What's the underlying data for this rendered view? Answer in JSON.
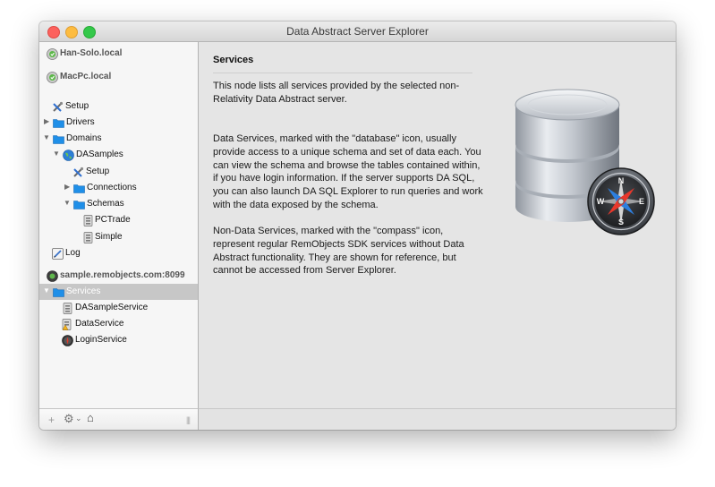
{
  "window": {
    "title": "Data Abstract Server Explorer"
  },
  "sidebar": {
    "tree": [
      {
        "label": "Han-Solo.local",
        "icon": "bonjour-server-icon",
        "kind": "server"
      },
      {
        "label": "MacPc.local",
        "icon": "bonjour-server-icon",
        "kind": "server"
      },
      {
        "label": "Setup",
        "icon": "tools-icon",
        "kind": "item"
      },
      {
        "label": "Drivers",
        "icon": "folder-icon",
        "kind": "folder",
        "expanded": false
      },
      {
        "label": "Domains",
        "icon": "folder-icon",
        "kind": "folder",
        "expanded": true
      },
      {
        "label": "DASamples",
        "icon": "globe-icon",
        "kind": "domain",
        "expanded": true
      },
      {
        "label": "Setup",
        "icon": "tools-icon",
        "kind": "item"
      },
      {
        "label": "Connections",
        "icon": "folder-icon",
        "kind": "folder",
        "expanded": false
      },
      {
        "label": "Schemas",
        "icon": "folder-icon",
        "kind": "folder",
        "expanded": true
      },
      {
        "label": "PCTrade",
        "icon": "schema-icon",
        "kind": "item"
      },
      {
        "label": "Simple",
        "icon": "schema-icon",
        "kind": "item"
      },
      {
        "label": "Log",
        "icon": "log-icon",
        "kind": "item"
      },
      {
        "label": "sample.remobjects.com:8099",
        "icon": "remote-server-icon",
        "kind": "server"
      },
      {
        "label": "Services",
        "icon": "folder-icon",
        "kind": "folder",
        "expanded": true,
        "selected": true
      },
      {
        "label": "DASampleService",
        "icon": "database-icon",
        "kind": "item"
      },
      {
        "label": "DataService",
        "icon": "database-warning-icon",
        "kind": "item"
      },
      {
        "label": "LoginService",
        "icon": "compass-icon",
        "kind": "item"
      }
    ],
    "toolbar": {
      "add": "+",
      "gear": "⚙",
      "gear_menu": "⌄",
      "home": "⌂",
      "grip": "|||"
    }
  },
  "content": {
    "heading": "Services",
    "paragraphs": [
      "This node lists all services provided by the selected non-Relativity Data Abstract server.",
      "Data Services, marked with the \"database\" icon, usually provide access to a unique schema and set of data each. You can view the schema and browse the tables contained within, if you have login information. If the server supports DA SQL, you can also launch DA SQL Explorer to run queries and work with the data exposed by the schema.",
      "Non-Data Services, marked with the \"compass\" icon, represent regular RemObjects SDK services without Data Abstract functionality. They are shown for reference, but cannot be accessed from Server Explorer."
    ],
    "illustration": "database-with-compass-icon",
    "compass_letters": {
      "n": "N",
      "e": "E",
      "s": "S",
      "w": "W"
    }
  },
  "colors": {
    "selection": "#c7c7c7",
    "folder": "#1f8fe8",
    "close": "#fc615d",
    "minimize": "#fdbc40",
    "maximize": "#34c84a"
  }
}
